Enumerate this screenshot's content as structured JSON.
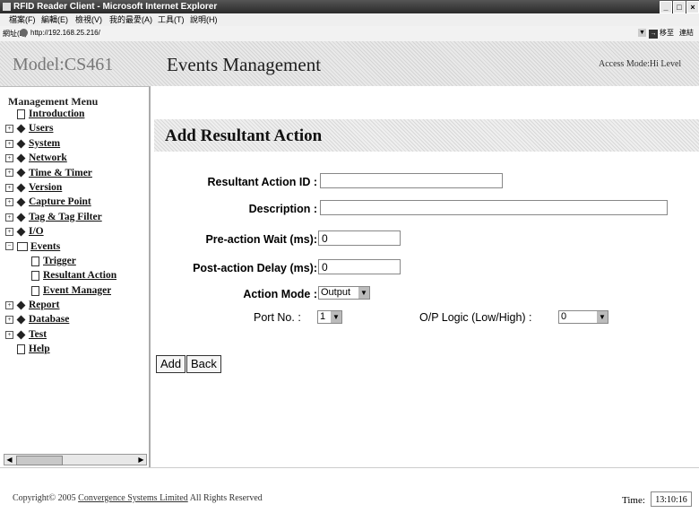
{
  "window": {
    "title": "RFID Reader Client - Microsoft Internet Explorer",
    "min_glyph": "_",
    "max_glyph": "□",
    "close_glyph": "×"
  },
  "menubar": {
    "items": [
      "檔案(F)",
      "編輯(E)",
      "檢視(V)",
      "我的最愛(A)",
      "工具(T)",
      "說明(H)"
    ]
  },
  "address_bar": {
    "label": "網址(D)",
    "url": "http://192.168.25.216/",
    "dropdown_glyph": "▼",
    "go_glyph": "→",
    "go_label": "移至",
    "links_label": "連結"
  },
  "header": {
    "model": "Model:CS461",
    "title": "Events Management",
    "access_mode": "Access Mode:Hi Level"
  },
  "sidebar": {
    "heading": "Management Menu",
    "items": [
      {
        "label": "Introduction"
      },
      {
        "label": "Users"
      },
      {
        "label": "System"
      },
      {
        "label": "Network"
      },
      {
        "label": "Time & Timer"
      },
      {
        "label": "Version"
      },
      {
        "label": "Capture Point"
      },
      {
        "label": "Tag & Tag Filter"
      },
      {
        "label": "I/O"
      },
      {
        "label": "Events"
      },
      {
        "label": "Trigger"
      },
      {
        "label": "Resultant Action"
      },
      {
        "label": "Event Manager"
      },
      {
        "label": "Report"
      },
      {
        "label": "Database"
      },
      {
        "label": "Test"
      },
      {
        "label": "Help"
      }
    ],
    "plus_glyph": "+",
    "minus_glyph": "−",
    "scroll_left": "◀",
    "scroll_right": "▶"
  },
  "form": {
    "heading": "Add Resultant Action",
    "fields": {
      "resultant_action_id": {
        "label": "Resultant Action ID :",
        "value": ""
      },
      "description": {
        "label": "Description :",
        "value": ""
      },
      "pre_action_wait": {
        "label": "Pre-action Wait (ms):",
        "value": "0"
      },
      "post_action_delay": {
        "label": "Post-action Delay (ms):",
        "value": "0"
      },
      "action_mode": {
        "label": "Action Mode :",
        "value": "Output"
      },
      "port_no": {
        "label": "Port No. :",
        "value": "1"
      },
      "op_logic": {
        "label": "O/P Logic (Low/High) :",
        "value": "0"
      }
    },
    "select_arrow": "▼",
    "add_button": "Add",
    "back_button": "Back"
  },
  "footer": {
    "copyright_prefix": "Copyright© 2005",
    "company": "Convergence Systems Limited",
    "rights": "All Rights Reserved",
    "time_label": "Time:",
    "time_value": "13:10:16"
  }
}
